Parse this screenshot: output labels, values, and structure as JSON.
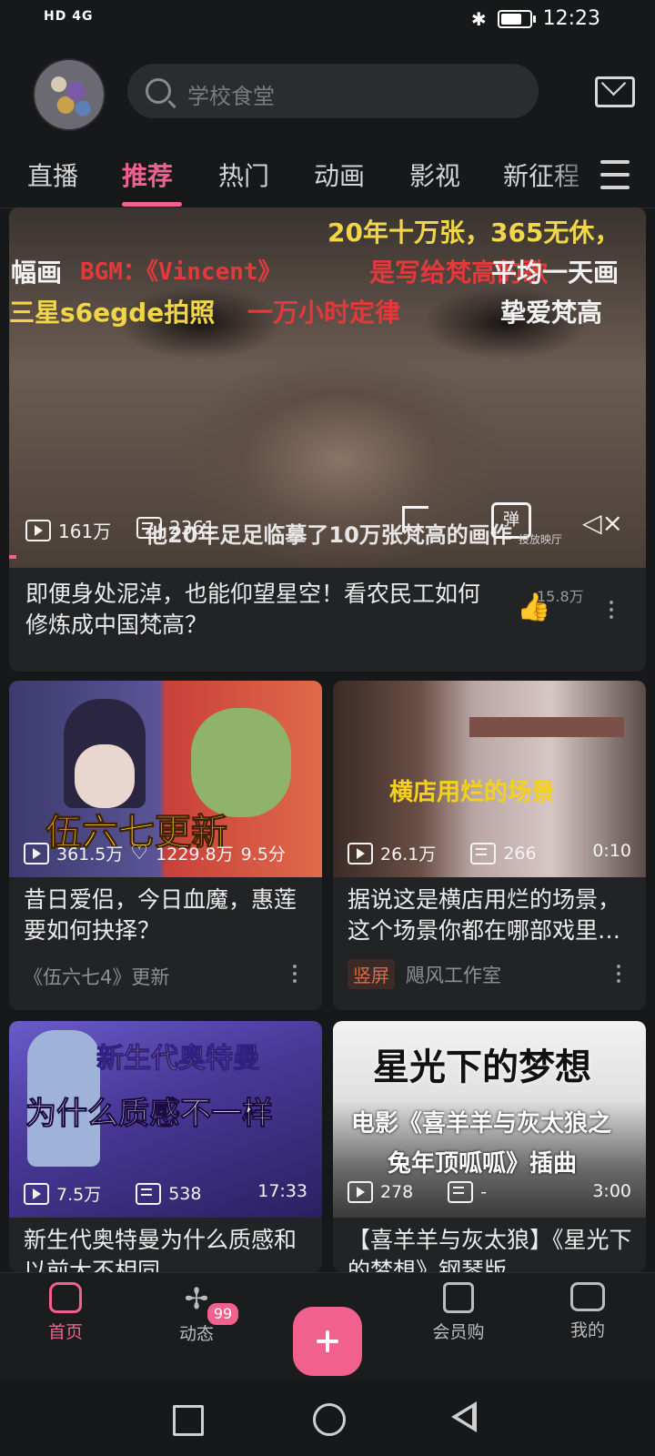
{
  "status_bar": {
    "left": "HD 4G",
    "time": "12:23"
  },
  "header": {
    "search_placeholder": "学校食堂"
  },
  "tabs": [
    {
      "label": "直播"
    },
    {
      "label": "推荐"
    },
    {
      "label": "热门"
    },
    {
      "label": "动画"
    },
    {
      "label": "影视"
    },
    {
      "label": "新征程"
    }
  ],
  "featured": {
    "overlay": {
      "line1": "20年十万张，365无休，",
      "line2a": "幅画",
      "line2b": "BGM：《Vincent》",
      "line2c": "是写给梵高的歌",
      "line2d": "平均一天画",
      "line3a": "三星s6egde拍照",
      "line3b": "一万小时定律",
      "line3c": "挚爱梵高",
      "caption": "他20年足足临摹了10万张梵高的画作",
      "danmaku_label": "弹",
      "cast_label": "投放映厅"
    },
    "plays": "161万",
    "danmaku": "2361",
    "title": "即便身处泥淖，也能仰望星空！看农民工如何修炼成中国梵高？",
    "likes": "15.8万"
  },
  "cards": [
    {
      "overlay": "伍六七更新",
      "plays": "361.5万",
      "likes": "1229.8万",
      "score": "9.5分",
      "title": "昔日爱侣，今日血魔，惠莲要如何抉择？",
      "sub": "《伍六七4》更新"
    },
    {
      "overlay": "横店用烂的场景",
      "plays": "26.1万",
      "danmaku": "266",
      "duration": "0:10",
      "title": "据说这是横店用烂的场景，这个场景你都在哪部戏里…",
      "tag": "竖屏",
      "sub": "飓风工作室"
    },
    {
      "overlay1": "新生代奥特曼",
      "overlay2": "为什么质感不一样",
      "plays": "7.5万",
      "danmaku": "538",
      "duration": "17:33",
      "title": "新生代奥特曼为什么质感和以前大不相同"
    },
    {
      "overlay1": "星光下的梦想",
      "overlay2": "电影《喜羊羊与灰太狼之",
      "overlay3": "兔年顶呱呱》插曲",
      "plays": "278",
      "danmaku": "-",
      "duration": "3:00",
      "title": "【喜羊羊与灰太狼】《星光下的梦想》钢琴版"
    }
  ],
  "bottom_nav": [
    {
      "label": "首页"
    },
    {
      "label": "动态"
    },
    {
      "label": "会员购"
    },
    {
      "label": "我的"
    }
  ],
  "badge": "99",
  "colors": {
    "accent": "#f0628d",
    "background": "#17181a",
    "card": "#222325"
  }
}
